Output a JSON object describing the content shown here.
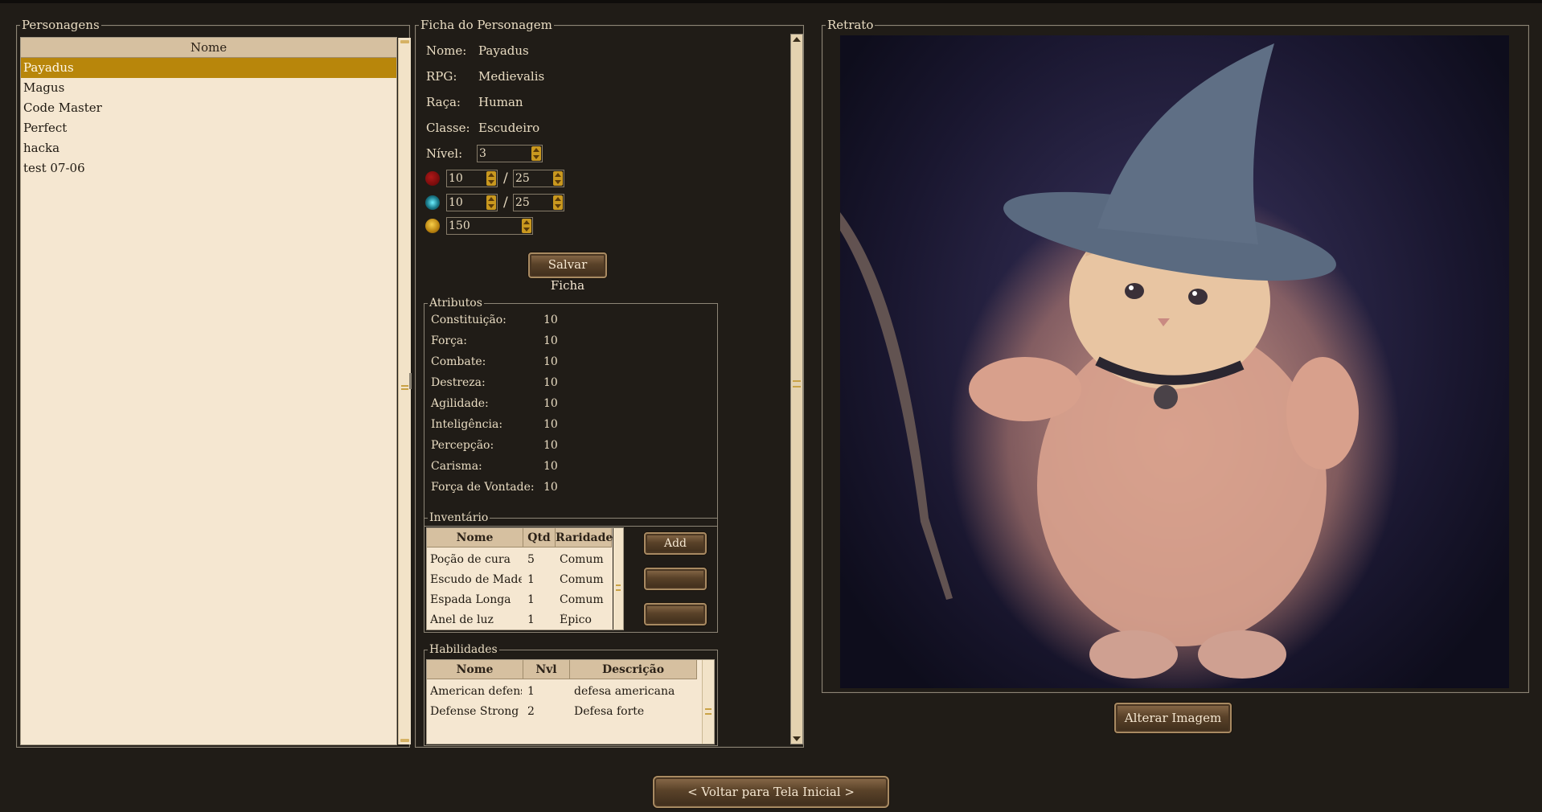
{
  "personagens": {
    "title": "Personagens",
    "header": "Nome",
    "items": [
      "Payadus",
      "Magus",
      "Code Master",
      "Perfect",
      "hacka",
      "test 07-06"
    ],
    "selected": "Payadus"
  },
  "ficha": {
    "title": "Ficha do Personagem",
    "nome_label": "Nome:",
    "nome": "Payadus",
    "rpg_label": "RPG:",
    "rpg": "Medievalis",
    "raca_label": "Raça:",
    "raca": "Human",
    "classe_label": "Classe:",
    "classe": "Escudeiro",
    "nivel_label": "Nível:",
    "nivel": "3",
    "vida": {
      "atual": "10",
      "max": "25",
      "icon": "heart-icon"
    },
    "mana": {
      "atual": "10",
      "max": "25",
      "icon": "mana-orb-icon"
    },
    "ouro": {
      "valor": "150",
      "icon": "gold-coin-icon"
    },
    "separator": "/",
    "salvar_label": "Salvar Ficha"
  },
  "atributos": {
    "title": "Atributos",
    "items": [
      {
        "nome": "Constituição:",
        "valor": "10"
      },
      {
        "nome": "Força:",
        "valor": "10"
      },
      {
        "nome": "Combate:",
        "valor": "10"
      },
      {
        "nome": "Destreza:",
        "valor": "10"
      },
      {
        "nome": "Agilidade:",
        "valor": "10"
      },
      {
        "nome": "Inteligência:",
        "valor": "10"
      },
      {
        "nome": "Percepção:",
        "valor": "10"
      },
      {
        "nome": "Carisma:",
        "valor": "10"
      },
      {
        "nome": "Força de Vontade:",
        "valor": "10"
      }
    ]
  },
  "inventario": {
    "title": "Inventário",
    "columns": [
      "Nome",
      "Qtd",
      "Raridade"
    ],
    "rows": [
      [
        "Poção de cura",
        "5",
        "Comum"
      ],
      [
        "Escudo de Madei",
        "1",
        "Comum"
      ],
      [
        "Espada Longa",
        "1",
        "Comum"
      ],
      [
        "Anel de luz",
        "1",
        "Épico"
      ]
    ],
    "add_label": "Add",
    "btn2_label": "",
    "btn3_label": ""
  },
  "habilidades": {
    "title": "Habilidades",
    "columns": [
      "Nome",
      "Nvl",
      "Descrição"
    ],
    "rows": [
      [
        "American defens",
        "1",
        "defesa americana"
      ],
      [
        "Defense Strong",
        "2",
        "Defesa forte"
      ]
    ]
  },
  "retrato": {
    "title": "Retrato",
    "alterar_label": "Alterar Imagem"
  },
  "footer": {
    "voltar_label": "< Voltar para Tela Inicial >"
  },
  "colors": {
    "background": "#201c17",
    "panel_bg": "#f5e7d1",
    "header_bg": "#d6c0a0",
    "selected": "#b8860b",
    "text_light": "#e9dcc2",
    "accent_gold": "#c9981f"
  }
}
